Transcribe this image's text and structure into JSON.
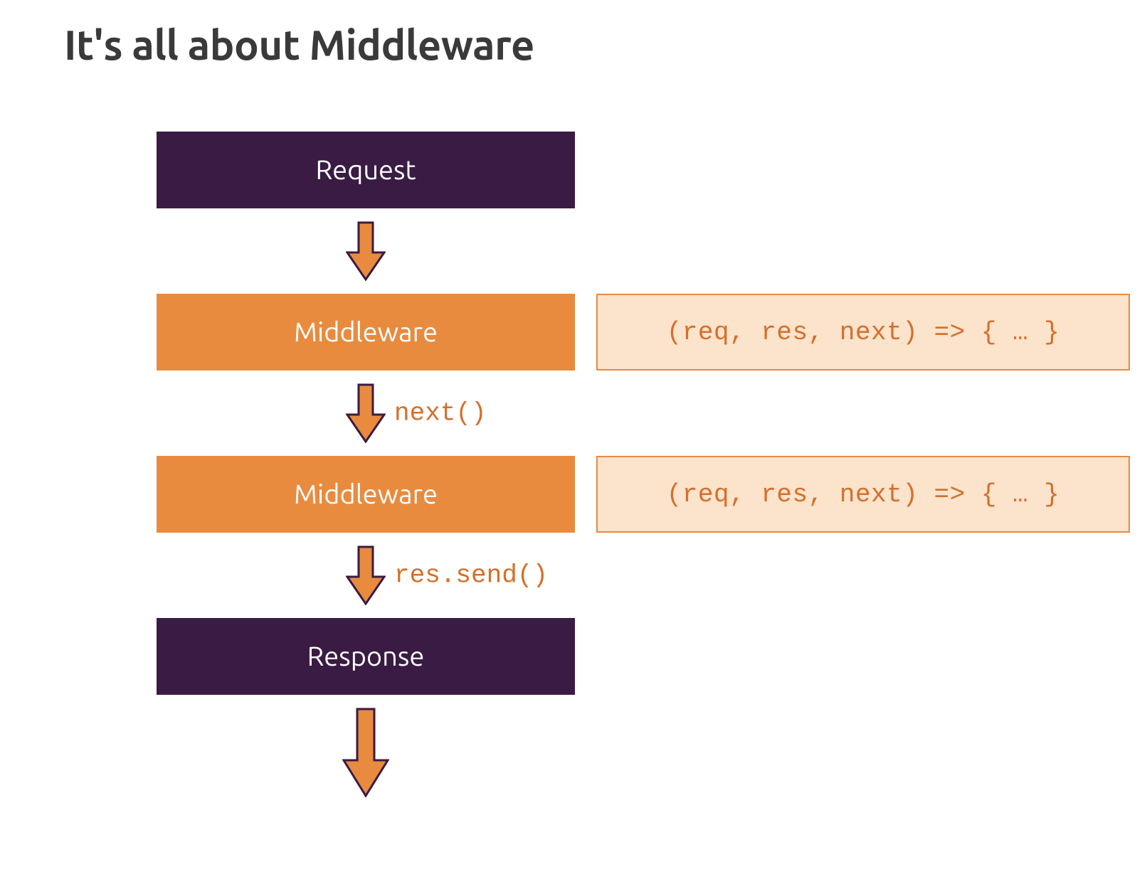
{
  "title": "It's all about Middleware",
  "colors": {
    "dark": "#3a1b43",
    "orange": "#e88b3f",
    "orange_text": "#d56f2a",
    "code_bg": "#fbe3cc"
  },
  "flow": {
    "request": "Request",
    "middleware1": "Middleware",
    "code1": "(req, res, next) => { … }",
    "arrow2_label": "next()",
    "middleware2": "Middleware",
    "code2": "(req, res, next) => { … }",
    "arrow3_label": "res.send()",
    "response": "Response"
  }
}
